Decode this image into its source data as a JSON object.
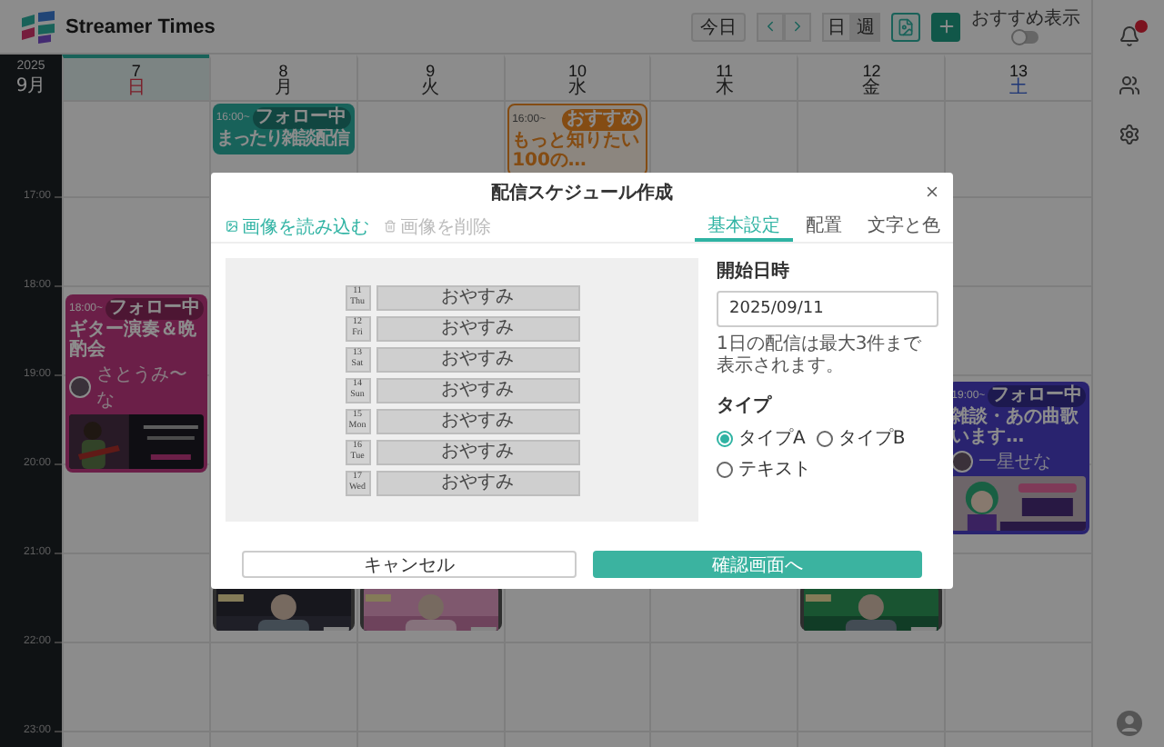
{
  "header": {
    "app_name": "Streamer Times",
    "today_button": "今日",
    "view_modes": [
      {
        "label": "日",
        "selected": false
      },
      {
        "label": "週",
        "selected": true
      }
    ],
    "recommend_toggle": {
      "label": "おすすめ表示",
      "on": false
    }
  },
  "sidebar": {
    "notifications_unread": true
  },
  "calendar": {
    "year": "2025",
    "month": "9月",
    "times": [
      "17:00",
      "18:00",
      "19:00",
      "20:00",
      "21:00",
      "22:00",
      "23:00"
    ],
    "days": [
      {
        "date": "7",
        "weekday": "日",
        "kind": "sunday",
        "selected": true,
        "events": [
          {
            "kind": "full",
            "color": "#6c2048",
            "time": "18:00~",
            "badge": "フォロー中",
            "title": "ギター演奏＆晩酌会",
            "streamer": "さとうみ〜な"
          }
        ]
      },
      {
        "date": "8",
        "weekday": "月",
        "kind": "weekday",
        "selected": false,
        "events": [
          {
            "kind": "brief",
            "color": "#18625b",
            "time": "16:00~",
            "badge": "フォロー中",
            "title": "まったり雑談配信"
          },
          {
            "kind": "picture"
          }
        ]
      },
      {
        "date": "9",
        "weekday": "火",
        "kind": "weekday",
        "selected": false,
        "events": [
          {
            "kind": "picture"
          }
        ]
      },
      {
        "date": "10",
        "weekday": "水",
        "kind": "weekday",
        "selected": false,
        "events": [
          {
            "kind": "recommend",
            "color": "#844c14",
            "time": "16:00~",
            "badge": "おすすめ",
            "title": "もっと知りたい100の…"
          }
        ]
      },
      {
        "date": "11",
        "weekday": "木",
        "kind": "weekday",
        "selected": false
      },
      {
        "date": "12",
        "weekday": "金",
        "kind": "weekday",
        "selected": false,
        "events": [
          {
            "kind": "picture"
          }
        ]
      },
      {
        "date": "13",
        "weekday": "土",
        "kind": "saturday",
        "selected": false,
        "events": [
          {
            "kind": "full",
            "color": "#29236f",
            "time": "19:00~",
            "badge": "フォロー中",
            "title": "雑談・あの曲歌います…",
            "streamer": "一星せな"
          }
        ]
      }
    ]
  },
  "dialog": {
    "title": "配信スケジュール作成",
    "toolbar": [
      {
        "label": "画像を読み込む",
        "kind": "load",
        "disabled": false
      },
      {
        "label": "画像を削除",
        "kind": "delete",
        "disabled": true
      }
    ],
    "tabs": [
      {
        "label": "基本設定",
        "selected": true
      },
      {
        "label": "配置",
        "selected": false
      },
      {
        "label": "文字と色",
        "selected": false
      }
    ],
    "preview_rows": [
      {
        "day": "11",
        "weekday": "Thu",
        "status": "おやすみ"
      },
      {
        "day": "12",
        "weekday": "Fri",
        "status": "おやすみ"
      },
      {
        "day": "13",
        "weekday": "Sat",
        "status": "おやすみ"
      },
      {
        "day": "14",
        "weekday": "Sun",
        "status": "おやすみ"
      },
      {
        "day": "15",
        "weekday": "Mon",
        "status": "おやすみ"
      },
      {
        "day": "16",
        "weekday": "Tue",
        "status": "おやすみ"
      },
      {
        "day": "17",
        "weekday": "Wed",
        "status": "おやすみ"
      }
    ],
    "form": {
      "date_label": "開始日時",
      "date_value": "2025/09/11",
      "note": "1日の配信は最大3件まで表示されます。",
      "type_label": "タイプ",
      "type_options": [
        {
          "label": "タイプA",
          "selected": true
        },
        {
          "label": "タイプB",
          "selected": false
        },
        {
          "label": "テキスト",
          "selected": false
        }
      ]
    },
    "buttons": [
      {
        "label": "キャンセル",
        "kind": "secondary"
      },
      {
        "label": "確認画面へ",
        "kind": "primary"
      }
    ]
  }
}
